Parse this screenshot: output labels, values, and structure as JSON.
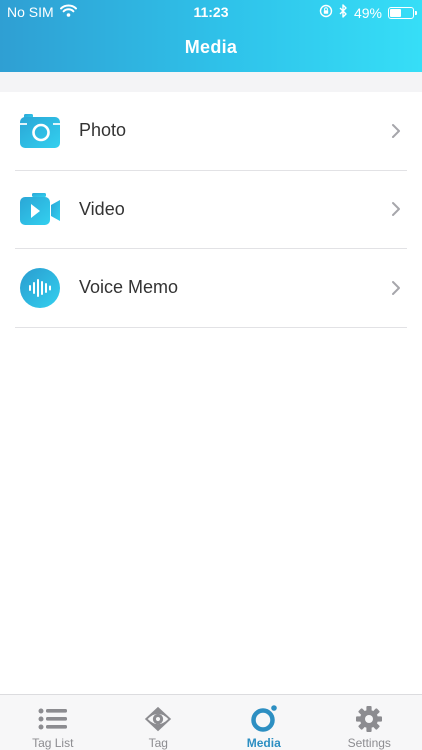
{
  "status_bar": {
    "carrier": "No SIM",
    "time": "11:23",
    "battery": "49%",
    "battery_level": 0.49
  },
  "header": {
    "title": "Media"
  },
  "media_items": [
    {
      "label": "Photo",
      "icon": "camera-icon"
    },
    {
      "label": "Video",
      "icon": "video-camera-icon"
    },
    {
      "label": "Voice Memo",
      "icon": "voice-wave-icon"
    }
  ],
  "tab_bar": {
    "tabs": [
      {
        "label": "Tag List",
        "icon": "list-icon",
        "active": false
      },
      {
        "label": "Tag",
        "icon": "eye-icon",
        "active": false
      },
      {
        "label": "Media",
        "icon": "media-ring-icon",
        "active": true
      },
      {
        "label": "Settings",
        "icon": "gear-icon",
        "active": false
      }
    ]
  },
  "colors": {
    "accent": "#2d8fc2",
    "header_start": "#2f9fd3",
    "header_end": "#36def7",
    "icon_gradient_start": "#2aa6d6",
    "icon_gradient_end": "#33d0ef"
  }
}
